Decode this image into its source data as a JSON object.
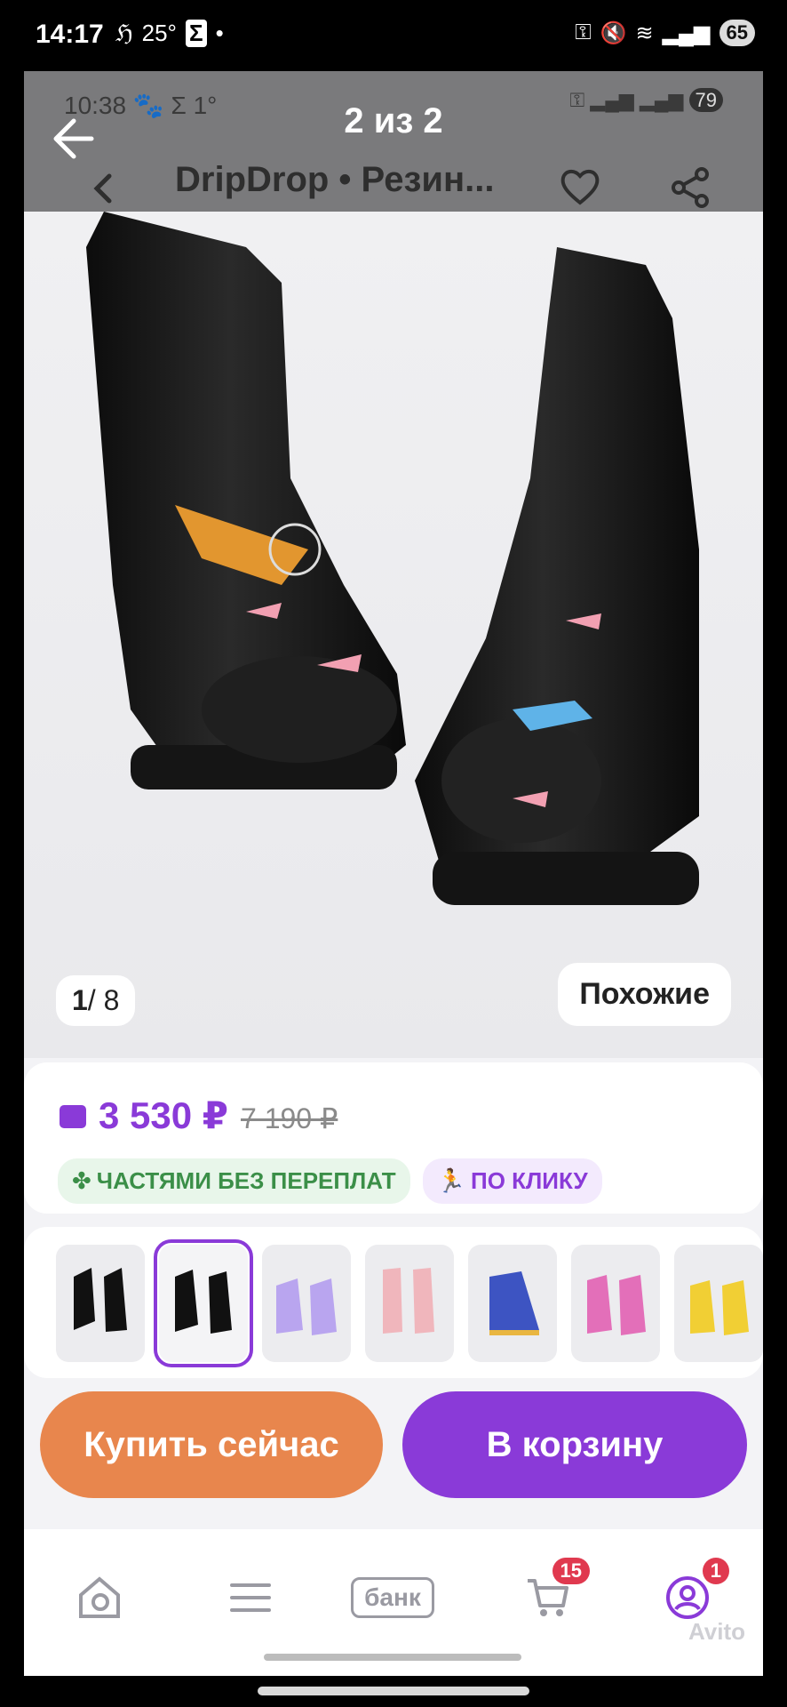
{
  "outer_status": {
    "time": "14:17",
    "notif_text": "25°",
    "battery": "65"
  },
  "viewer": {
    "counter": "2 из 2"
  },
  "inner_status": {
    "time": "10:38",
    "notif": "1°",
    "battery": "79"
  },
  "product": {
    "title": "DripDrop • Резин...",
    "page_current": "1",
    "page_total": "/ 8",
    "similar_label": "Похожие",
    "price_now": "3 530 ₽",
    "price_old": "7 190 ₽",
    "chip_installments": "ЧАСТЯМИ БЕЗ ПЕРЕПЛАТ",
    "chip_oneclick": "ПО КЛИКУ"
  },
  "actions": {
    "buy_now": "Купить сейчас",
    "to_cart": "В корзину"
  },
  "nav": {
    "bank_label": "банк",
    "cart_badge": "15",
    "profile_badge": "1"
  },
  "watermark": "Avito",
  "colors": {
    "accent": "#8a3ad8",
    "buy": "#e8864d",
    "badge": "#e0394f"
  }
}
